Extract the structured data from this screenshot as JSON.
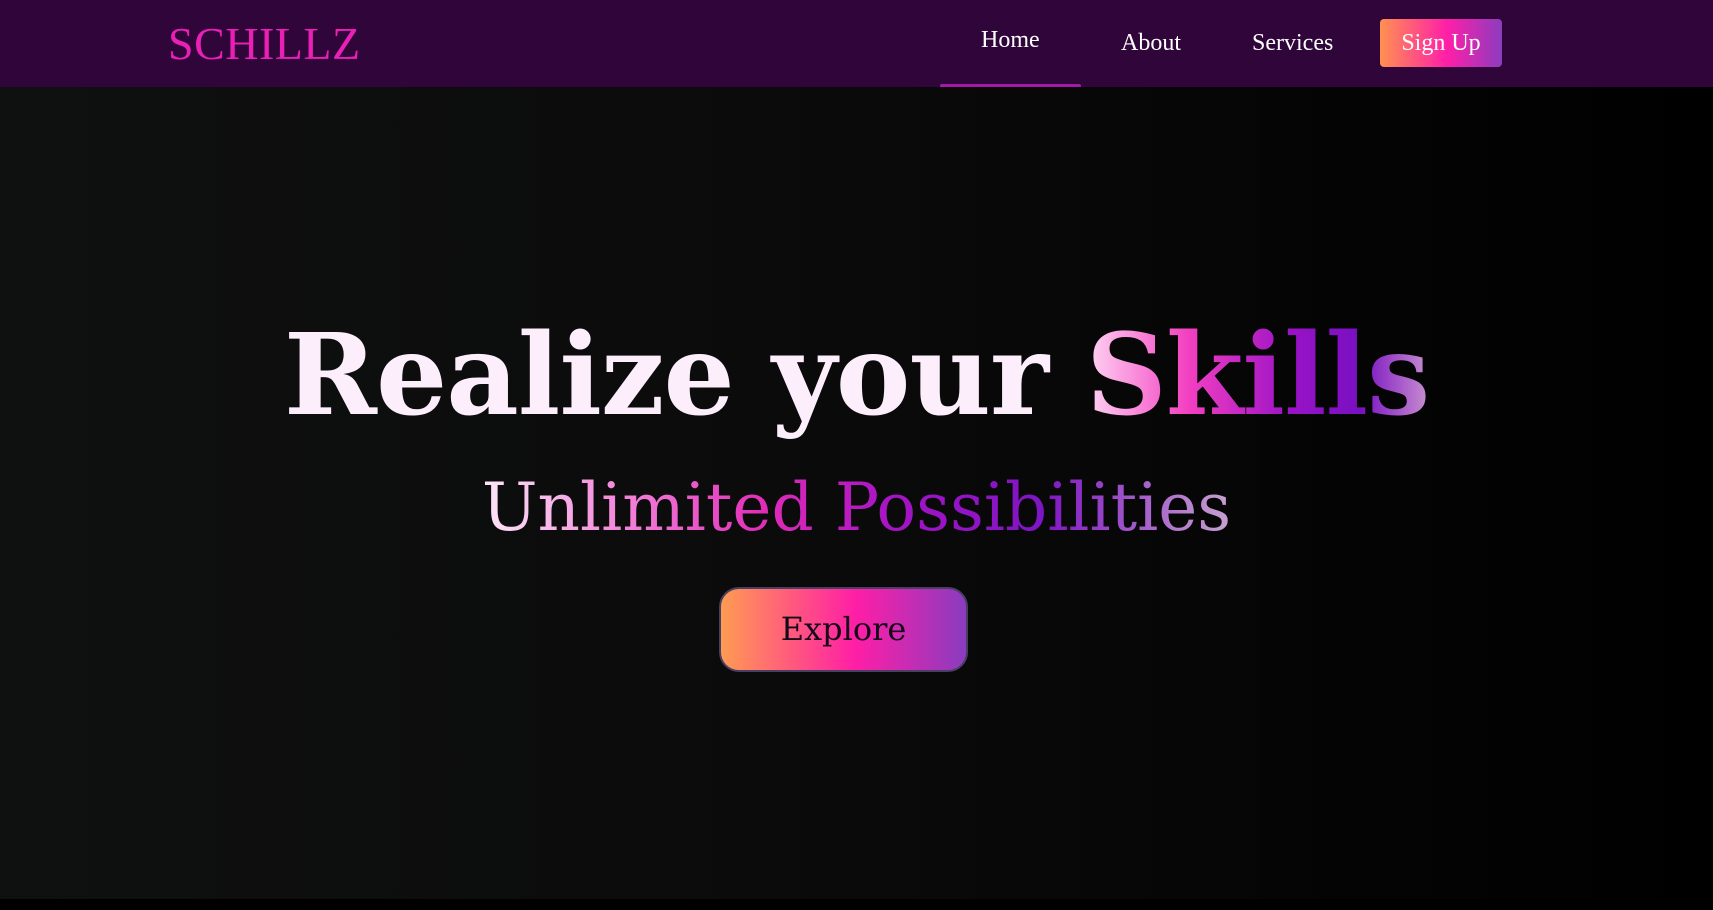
{
  "navbar": {
    "logo": "SCHILLZ",
    "links": [
      {
        "label": "Home",
        "active": true
      },
      {
        "label": "About",
        "active": false
      },
      {
        "label": "Services",
        "active": false
      }
    ],
    "signup_label": "Sign Up"
  },
  "hero": {
    "title_prefix": "Realize your ",
    "title_accent": "Skills",
    "subtitle": "Unlimited Possibilities",
    "cta_label": "Explore"
  },
  "colors": {
    "navbar_bg": "#30053a",
    "logo": "#e91fb6",
    "active_underline": "#a31aa8",
    "gradient_orange": "#ff9150",
    "gradient_pink": "#ff1fa8",
    "gradient_purple": "#8c3cbf"
  }
}
